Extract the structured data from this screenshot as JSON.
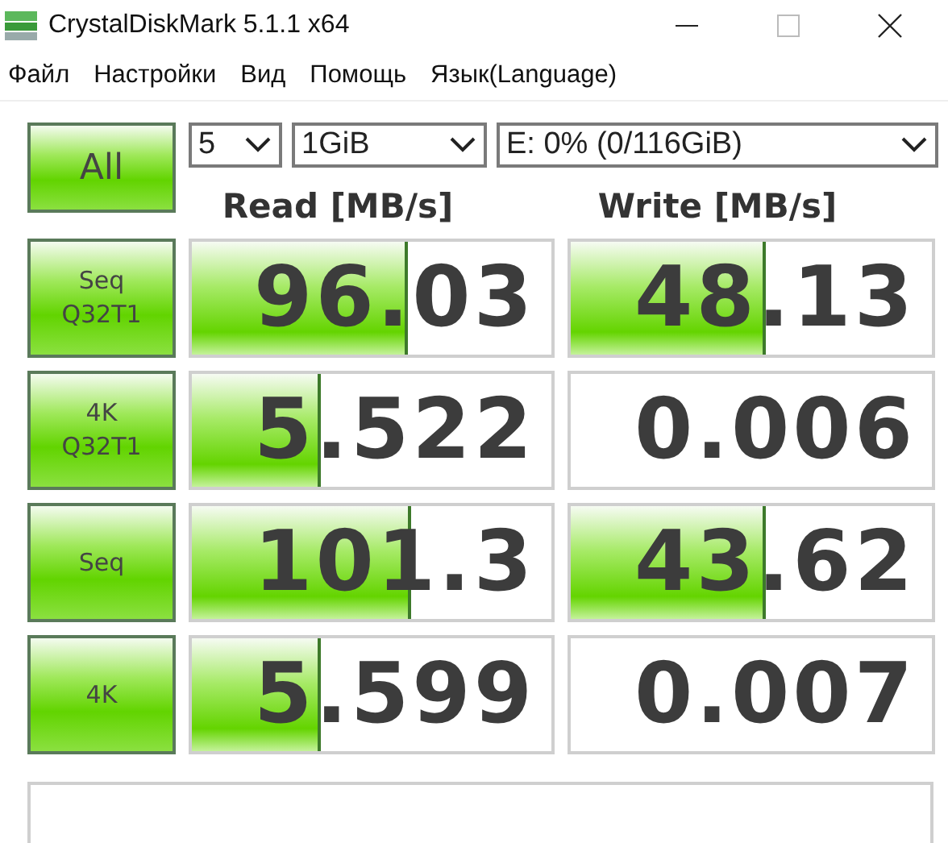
{
  "window": {
    "title": "CrystalDiskMark 5.1.1 x64"
  },
  "menu": [
    "Файл",
    "Настройки",
    "Вид",
    "Помощь",
    "Язык(Language)"
  ],
  "all_button": "All",
  "selects": {
    "count": "5",
    "size": "1GiB",
    "drive": "E: 0% (0/116GiB)"
  },
  "headers": {
    "read": "Read [MB/s]",
    "write": "Write [MB/s]"
  },
  "rows": [
    {
      "label": [
        "Seq",
        "Q32T1"
      ],
      "read": {
        "value": "96.03",
        "level": 0.59
      },
      "write": {
        "value": "48.13",
        "level": 0.53
      }
    },
    {
      "label": [
        "4K",
        "Q32T1"
      ],
      "read": {
        "value": "5.522",
        "level": 0.35
      },
      "write": {
        "value": "0.006"
      }
    },
    {
      "label": [
        "Seq"
      ],
      "read": {
        "value": "101.3",
        "level": 0.6
      },
      "write": {
        "value": "43.62",
        "level": 0.53
      }
    },
    {
      "label": [
        "4K"
      ],
      "read": {
        "value": "5.599",
        "level": 0.35
      },
      "write": {
        "value": "0.007"
      }
    }
  ]
}
